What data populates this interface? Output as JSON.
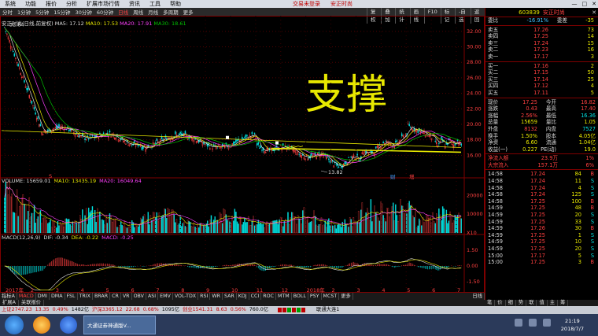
{
  "menu": [
    "系统",
    "功能",
    "报价",
    "分析",
    "扩展市场行情",
    "资讯",
    "工具",
    "帮助"
  ],
  "window_title": "交易未登录",
  "window_subtitle": "安正时尚",
  "periods": [
    "分时",
    "1分钟",
    "5分钟",
    "15分钟",
    "30分钟",
    "60分钟",
    "日线",
    "周线",
    "月线",
    "多周期",
    "更多"
  ],
  "active_period": "日线",
  "toolbar_right": [
    "复权",
    "叠加",
    "统计",
    "画线",
    "F10",
    "标记",
    "-自选",
    "返回"
  ],
  "ma_legend": {
    "title": "安正时尚(日线,前复权)",
    "ma5": "MA5: 17.12",
    "ma10": "MA10: 17.53",
    "ma20": "MA20: 17.91",
    "ma30": "MA30: 18.61"
  },
  "vol_legend": {
    "title": "VOLUME: 15659.01",
    "ma10": "MA10: 13435.19",
    "ma20": "MA20: 16049.64"
  },
  "macd_legend": {
    "title": "MACD(12,26,9)",
    "dif": "DIF: -0.34",
    "dea": "DEA: -0.22",
    "macd": "MACD: -0.25"
  },
  "price_axis": [
    "32.00",
    "30.00",
    "28.00",
    "26.00",
    "24.00",
    "22.00",
    "20.00",
    "18.00",
    "16.00"
  ],
  "high_label": "32.84",
  "low_label": "13.82",
  "vol_axis": [
    "20000",
    "10000",
    "X10"
  ],
  "macd_axis": [
    "1.50",
    "0.00",
    "-1.50"
  ],
  "date_axis": [
    "2017年",
    "2",
    "3",
    "4",
    "5",
    "6",
    "7",
    "8",
    "9",
    "10",
    "11",
    "12",
    "2018年",
    "2",
    "3",
    "4",
    "5",
    "6",
    "7"
  ],
  "annotation": "支撑",
  "badges": {
    "b1": "财",
    "b2": "增"
  },
  "stock": {
    "code": "603839",
    "name": "安正时尚"
  },
  "weibi": {
    "label": "委比",
    "value": "-16.91%",
    "label2": "委差",
    "value2": "-35"
  },
  "asks": [
    {
      "label": "卖五",
      "price": "17.26",
      "vol": "73"
    },
    {
      "label": "卖四",
      "price": "17.25",
      "vol": "14"
    },
    {
      "label": "卖三",
      "price": "17.24",
      "vol": "15"
    },
    {
      "label": "卖二",
      "price": "17.23",
      "vol": "16"
    },
    {
      "label": "卖一",
      "price": "17.17",
      "vol": "3"
    }
  ],
  "bids": [
    {
      "label": "买一",
      "price": "17.16",
      "vol": "2"
    },
    {
      "label": "买二",
      "price": "17.15",
      "vol": "50"
    },
    {
      "label": "买三",
      "price": "17.14",
      "vol": "25"
    },
    {
      "label": "买四",
      "price": "17.12",
      "vol": "4"
    },
    {
      "label": "买五",
      "price": "17.11",
      "vol": "5"
    }
  ],
  "quote": [
    {
      "k1": "现价",
      "v1": "17.25",
      "k2": "今开",
      "v2": "16.82"
    },
    {
      "k1": "涨跌",
      "v1": "0.43",
      "k2": "最高",
      "v2": "17.40"
    },
    {
      "k1": "涨幅",
      "v1": "2.56%",
      "k2": "最低",
      "v2": "16.36"
    },
    {
      "k1": "总量",
      "v1": "15659",
      "k2": "量比",
      "v2": "1.05"
    },
    {
      "k1": "外盘",
      "v1": "8132",
      "k2": "内盘",
      "v2": "7527"
    },
    {
      "k1": "换手",
      "v1": "1.50%",
      "k2": "股本",
      "v2": "4.05亿"
    },
    {
      "k1": "净资",
      "v1": "6.60",
      "k2": "流通",
      "v2": "1.04亿"
    },
    {
      "k1": "收益(一)",
      "v1": "0.227",
      "k2": "PE(动)",
      "v2": "19.0"
    }
  ],
  "flow": [
    {
      "k": "净流入额",
      "v": "23.9万",
      "p": "1%"
    },
    {
      "k": "大宗流入",
      "v": "157.1万",
      "p": "6%"
    }
  ],
  "ticks": [
    {
      "t": "14:58",
      "p": "17.24",
      "v": "84",
      "s": "B"
    },
    {
      "t": "14:58",
      "p": "17.24",
      "v": "11",
      "s": "S"
    },
    {
      "t": "14:58",
      "p": "17.24",
      "v": "4",
      "s": "S"
    },
    {
      "t": "14:58",
      "p": "17.24",
      "v": "125",
      "s": "S"
    },
    {
      "t": "14:58",
      "p": "17.25",
      "v": "100",
      "s": "B"
    },
    {
      "t": "14:59",
      "p": "17.25",
      "v": "48",
      "s": "B"
    },
    {
      "t": "14:59",
      "p": "17.25",
      "v": "20",
      "s": "S"
    },
    {
      "t": "14:59",
      "p": "17.25",
      "v": "33",
      "s": "S"
    },
    {
      "t": "14:59",
      "p": "17.26",
      "v": "30",
      "s": "B"
    },
    {
      "t": "14:59",
      "p": "17.25",
      "v": "1",
      "s": "S"
    },
    {
      "t": "14:59",
      "p": "17.25",
      "v": "10",
      "s": "S"
    },
    {
      "t": "14:59",
      "p": "17.25",
      "v": "20",
      "s": "S"
    },
    {
      "t": "15:00",
      "p": "17.17",
      "v": "5",
      "s": "S"
    },
    {
      "t": "15:00",
      "p": "17.25",
      "v": "3",
      "s": "B"
    }
  ],
  "indicator_tabs": [
    "指标A",
    "MACD",
    "DMI",
    "DMA",
    "FSL",
    "TRIX",
    "BRAR",
    "CR",
    "VR",
    "OBV",
    "ASI",
    "EMV",
    "VOL-TDX",
    "RSI",
    "WR",
    "SAR",
    "KDJ",
    "CCI",
    "ROC",
    "MTM",
    "BOLL",
    "PSY",
    "MCST",
    "更多"
  ],
  "active_indicator": "MACD",
  "bottom_right_tabs": [
    "笔",
    "价",
    "细",
    "势",
    "联",
    "值",
    "主",
    "筹"
  ],
  "period_right": "日线",
  "sub_tabs": [
    "扩展A",
    "关联报价"
  ],
  "status": {
    "sh": "上证2747.23",
    "sh_chg": "13.35",
    "sh_pct": "0.49%",
    "sh_amt": "1482亿",
    "hs": "沪深3365.12",
    "hs_chg": "22.68",
    "hs_pct": "0.68%",
    "hs_amt": "1095亿",
    "cy": "创业1541.31",
    "cy_chg": "8.63",
    "cy_pct": "0.56%",
    "cy_amt": "760.0亿",
    "conn": "联通大连1"
  },
  "taskbar": {
    "task": "大通证券神通版V...",
    "time": "21:19",
    "date": "2018/7/7"
  },
  "colors": {
    "up": "#ff4040",
    "down": "#00e0e0",
    "ma5": "#e0e0e0",
    "ma10": "#e8e800",
    "ma20": "#ff40ff",
    "ma30": "#00c000",
    "annotation": "#e8e800"
  }
}
